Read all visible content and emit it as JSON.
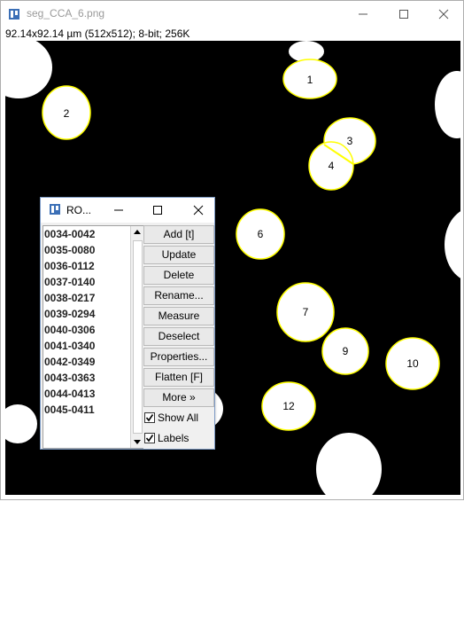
{
  "window": {
    "title": "seg_CCA_6.png",
    "info": "92.14x92.14 µm (512x512); 8-bit; 256K"
  },
  "image": {
    "labels": [
      "1",
      "2",
      "3",
      "4",
      "6",
      "7",
      "9",
      "10",
      "12"
    ],
    "colors": {
      "background": "#000000",
      "cell": "#ffffff",
      "roi_outline": "#ffff00"
    }
  },
  "roi_manager": {
    "title": "RO...",
    "items": [
      "0034-0042",
      "0035-0080",
      "0036-0112",
      "0037-0140",
      "0038-0217",
      "0039-0294",
      "0040-0306",
      "0041-0340",
      "0042-0349",
      "0043-0363",
      "0044-0413",
      "0045-0411"
    ],
    "buttons": {
      "add": "Add [t]",
      "update": "Update",
      "delete": "Delete",
      "rename": "Rename...",
      "measure": "Measure",
      "deselect": "Deselect",
      "properties": "Properties...",
      "flatten": "Flatten [F]",
      "more": "More »"
    },
    "checkboxes": {
      "show_all": {
        "label": "Show All",
        "checked": true
      },
      "labels": {
        "label": "Labels",
        "checked": true
      }
    }
  }
}
